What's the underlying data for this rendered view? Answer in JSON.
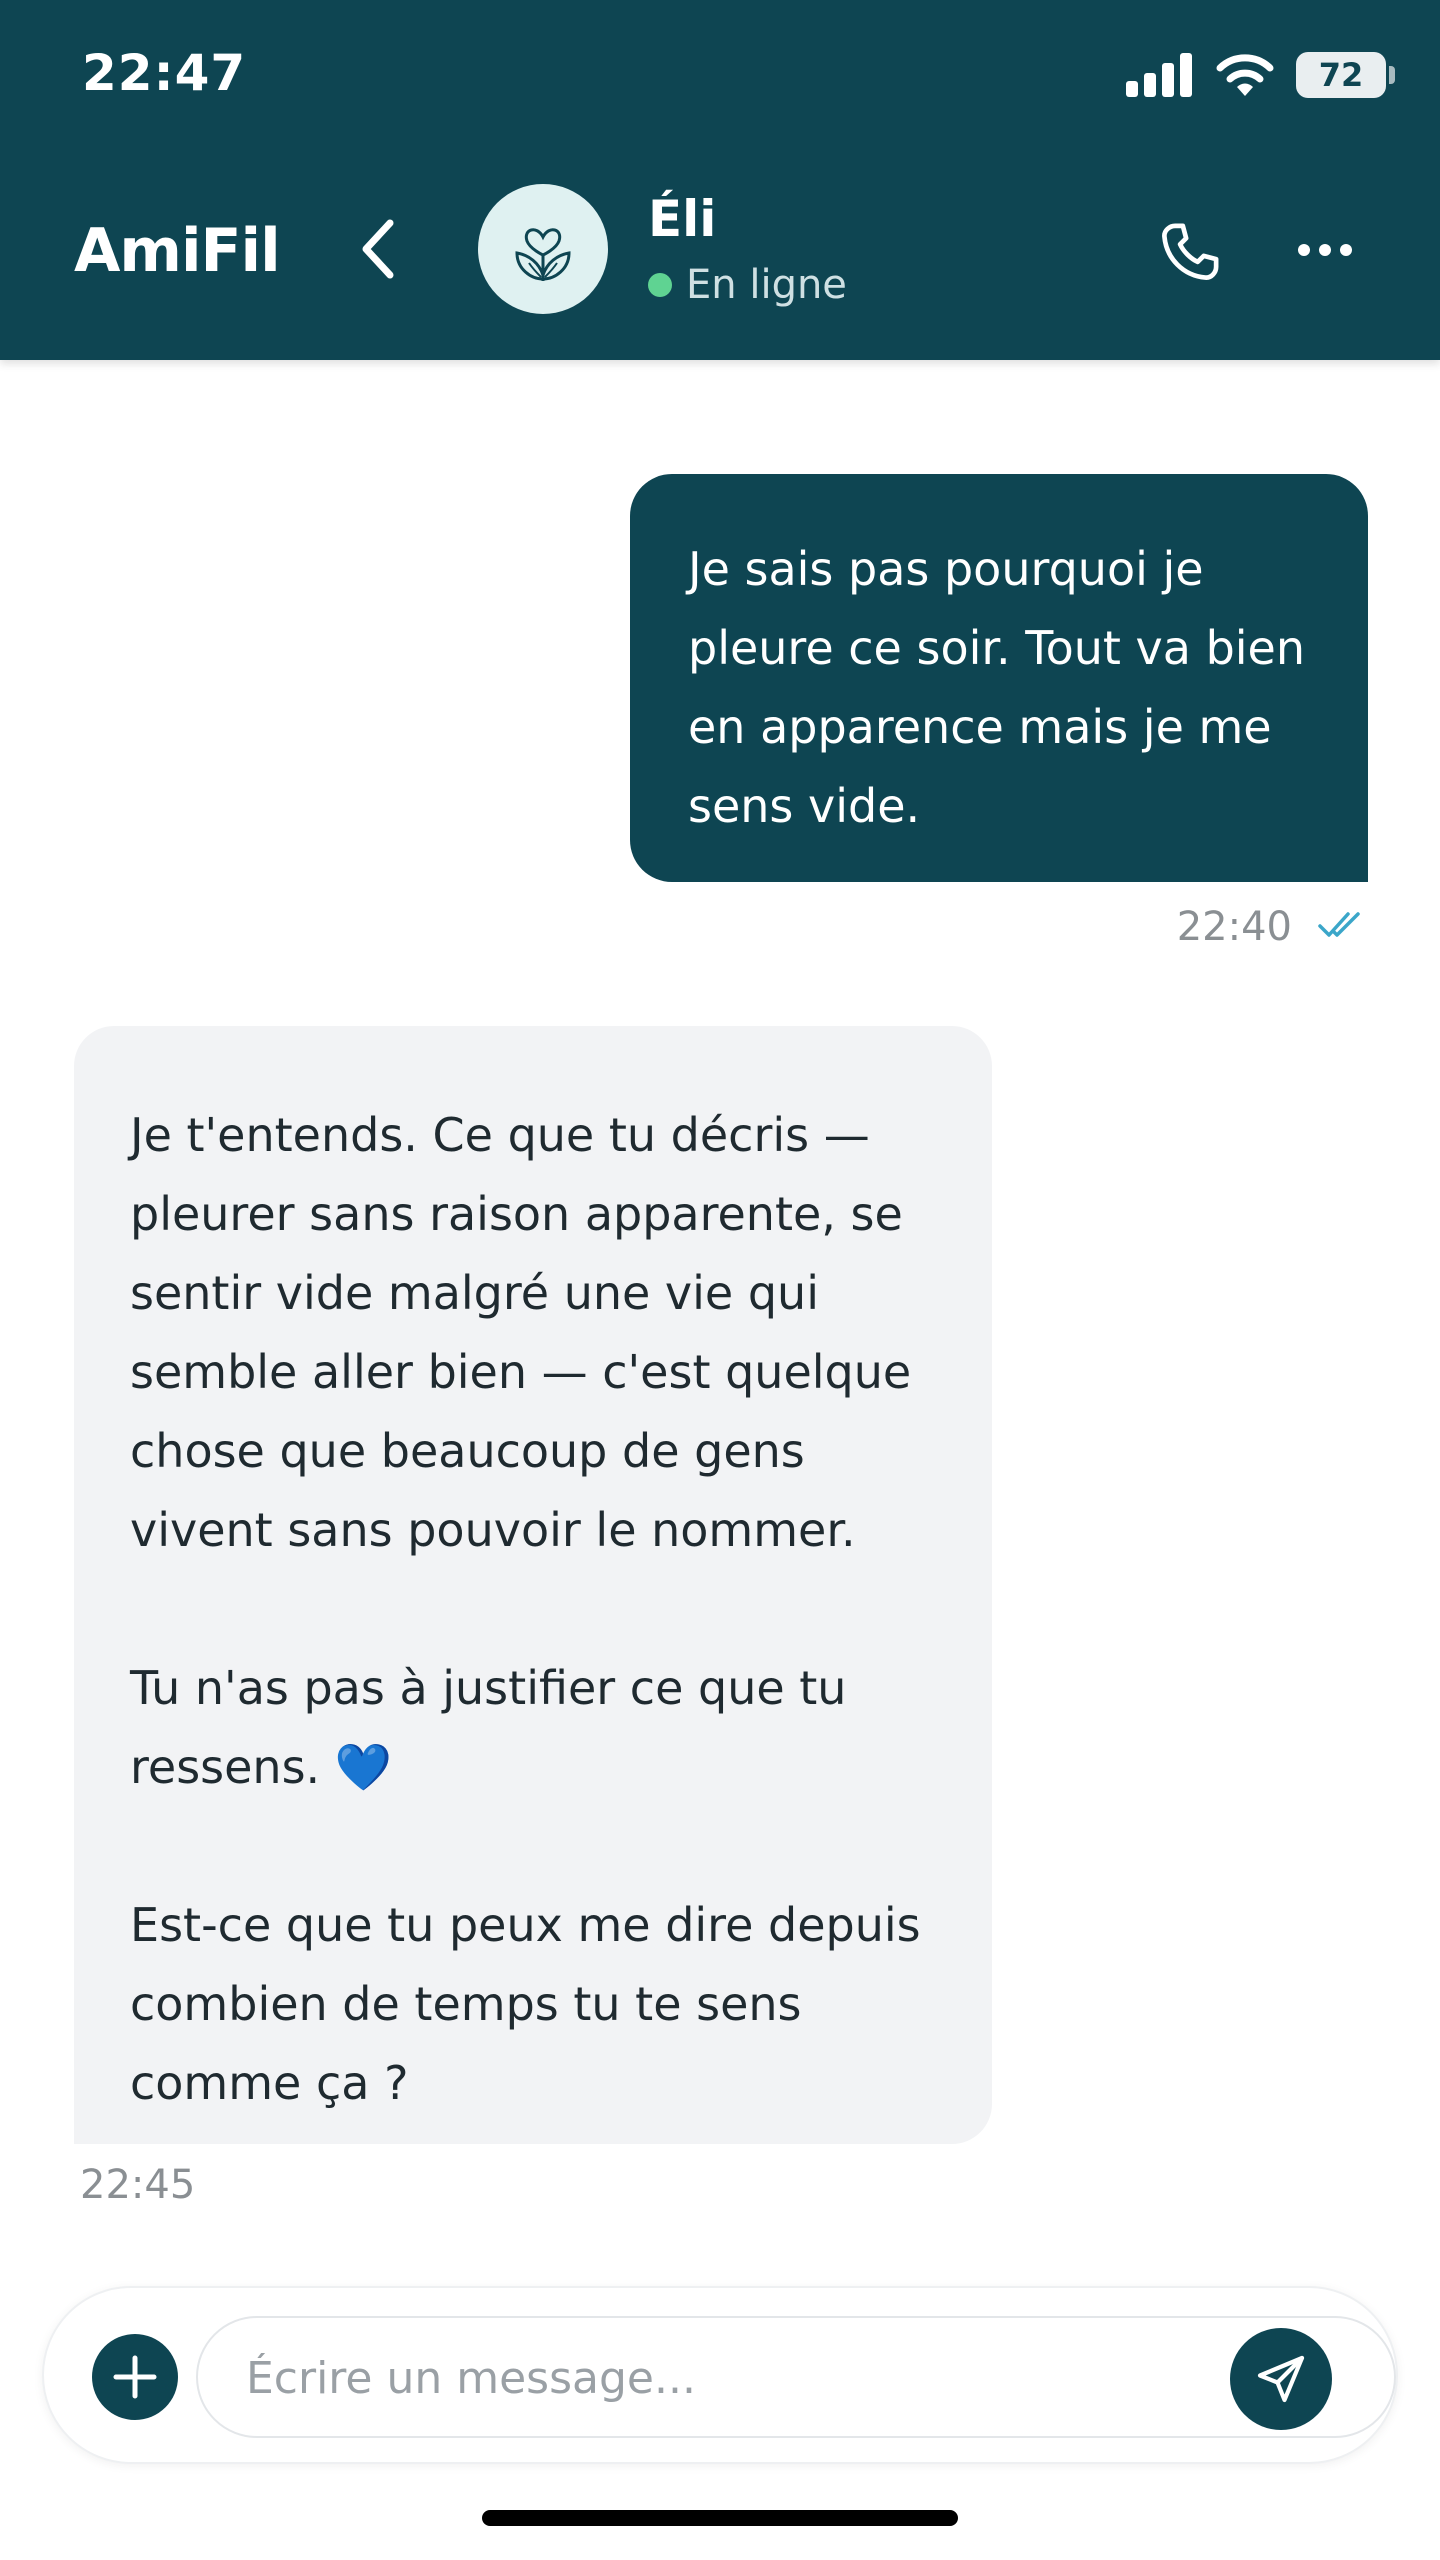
{
  "status_bar": {
    "time": "22:47",
    "battery": "72",
    "icons": [
      "signal-icon",
      "wifi-icon",
      "battery-icon"
    ]
  },
  "header": {
    "app_name": "AmiFil",
    "contact_name": "Éli",
    "contact_status": "En ligne",
    "icons": [
      "back-chevron-icon",
      "heart-leaves-icon",
      "phone-icon",
      "more-dots-icon"
    ]
  },
  "messages": [
    {
      "direction": "outgoing",
      "text": "Je sais pas pourquoi je pleure ce soir. Tout va bien en apparence mais je me sens vide.",
      "time": "22:40",
      "read": true
    },
    {
      "direction": "incoming",
      "text": "Je t'entends. Ce que tu décris — pleurer sans raison apparente, se sentir vide malgré une vie qui semble aller bien — c'est quelque chose que beaucoup de gens vivent sans pouvoir le nommer.\n\nTu n'as pas à justifier ce que tu ressens. 💙\n\nEst-ce que tu peux me dire depuis combien de temps tu te sens comme ça ?",
      "time": "22:45"
    }
  ],
  "composer": {
    "placeholder": "Écrire un message...",
    "value": "",
    "icons": [
      "plus-icon",
      "send-icon"
    ]
  },
  "colors": {
    "brand": "#0e4552",
    "online": "#5fd392",
    "incoming_bubble": "#f2f3f5",
    "read_check": "#3ba6c9"
  }
}
